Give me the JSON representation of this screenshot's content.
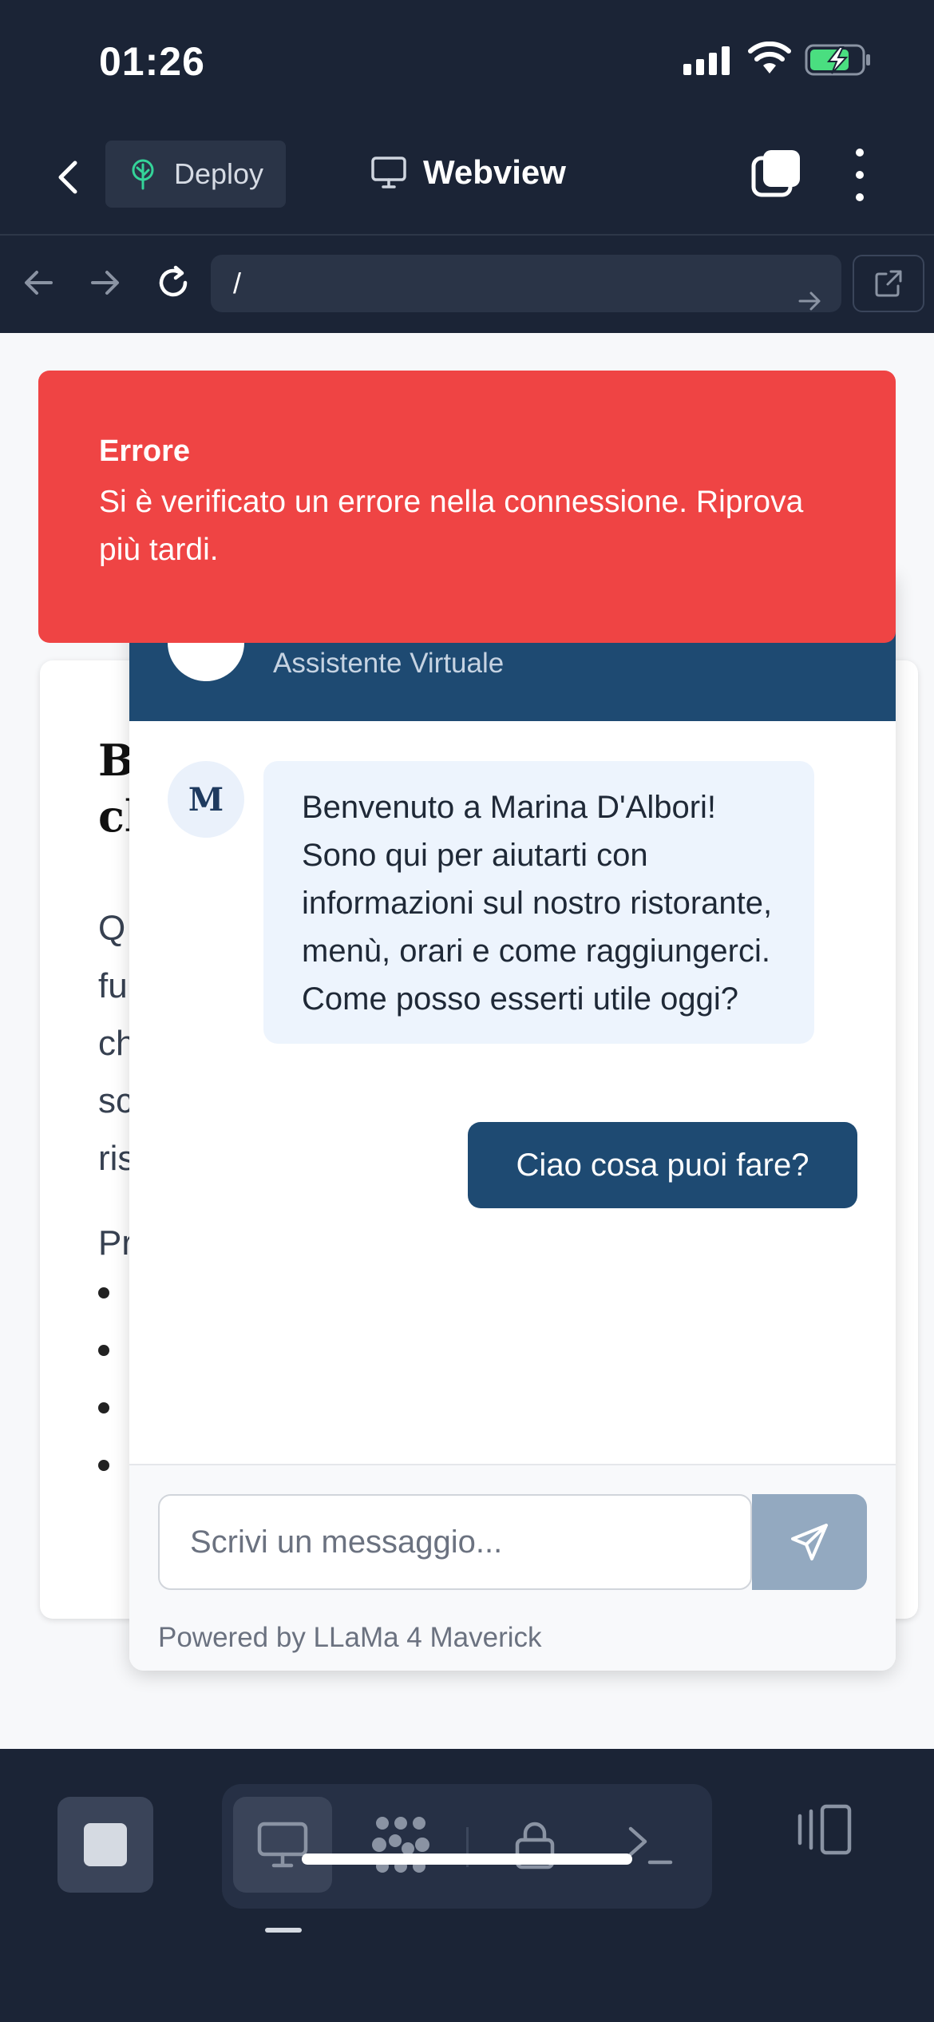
{
  "status_bar": {
    "time": "01:26"
  },
  "header": {
    "deploy_label": "Deploy",
    "title": "Webview"
  },
  "url_bar": {
    "url": "/"
  },
  "background_page": {
    "title_line1": "B",
    "title_line2": "cl",
    "para_lines": [
      "Q",
      "fu",
      "ch",
      "sc",
      "ris"
    ],
    "section_start": "Pr"
  },
  "chat": {
    "subtitle": "Assistente Virtuale",
    "bot_avatar": "M",
    "bot_message": "Benvenuto a Marina D'Albori! Sono qui per aiutarti con informazioni sul nostro ristorante, menù, orari e come raggiungerci. Come posso esserti utile oggi?",
    "user_message": "Ciao cosa puoi fare?",
    "input_placeholder": "Scrivi un messaggio...",
    "powered_by": "Powered by LLaMa 4 Maverick"
  },
  "error_toast": {
    "title": "Errore",
    "message": "Si è verificato un errore nella connessione. Riprova più tardi."
  },
  "colors": {
    "chrome_bg": "#1b2436",
    "chat_header": "#1e4a72",
    "error": "#ef4444",
    "bot_bubble": "#edf4fd"
  },
  "icons": {
    "back": "chevron-left-icon",
    "deploy": "tree-icon",
    "webview": "monitor-icon",
    "tabs": "tabs-icon",
    "more": "more-vertical-icon",
    "send": "send-icon",
    "bottom_tools": [
      "monitor-icon",
      "dots-grid-icon",
      "lock-icon",
      "terminal-icon"
    ],
    "panel": "panel-icon"
  }
}
